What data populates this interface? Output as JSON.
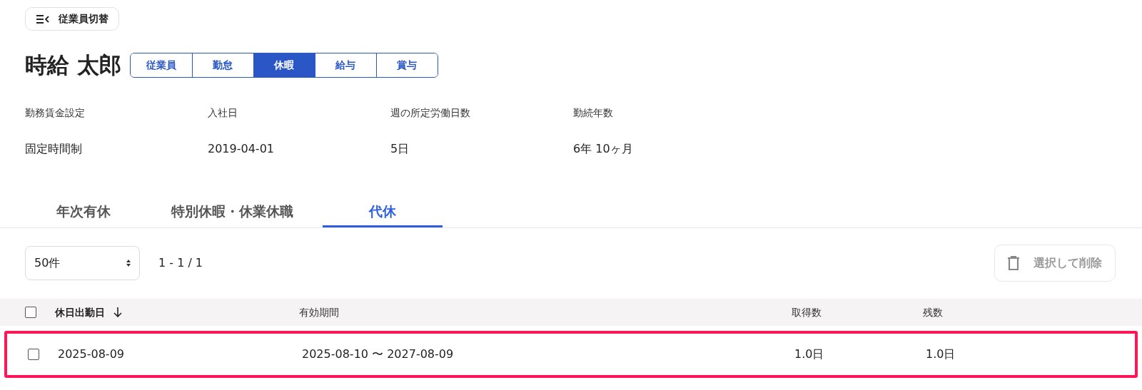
{
  "switch_button": {
    "label": "従業員切替"
  },
  "employee_name": "時給 太郎",
  "section_tabs": [
    {
      "label": "従業員",
      "selected": false
    },
    {
      "label": "勤怠",
      "selected": false
    },
    {
      "label": "休暇",
      "selected": true
    },
    {
      "label": "給与",
      "selected": false
    },
    {
      "label": "賞与",
      "selected": false
    }
  ],
  "info": [
    {
      "label": "勤務賃金設定",
      "value": "固定時間制"
    },
    {
      "label": "入社日",
      "value": "2019-04-01"
    },
    {
      "label": "週の所定労働日数",
      "value": "5日"
    },
    {
      "label": "勤続年数",
      "value": "6年 10ヶ月"
    }
  ],
  "leave_tabs": [
    {
      "label": "年次有休",
      "selected": false
    },
    {
      "label": "特別休暇・休業休職",
      "selected": false
    },
    {
      "label": "代休",
      "selected": true
    }
  ],
  "page_size": {
    "value": "50件"
  },
  "pagination": "1 - 1 / 1",
  "delete_button": {
    "label": "選択して削除",
    "disabled": true
  },
  "table": {
    "columns": [
      {
        "label": "休日出勤日",
        "sorted": true
      },
      {
        "label": "有効期間",
        "sorted": false
      },
      {
        "label": "取得数",
        "sorted": false
      },
      {
        "label": "残数",
        "sorted": false
      }
    ],
    "header_checked": false,
    "rows": [
      {
        "checked": false,
        "highlighted": true,
        "cells": [
          "2025-08-09",
          "2025-08-10 〜 2027-08-09",
          "1.0日",
          "1.0日"
        ]
      }
    ]
  }
}
